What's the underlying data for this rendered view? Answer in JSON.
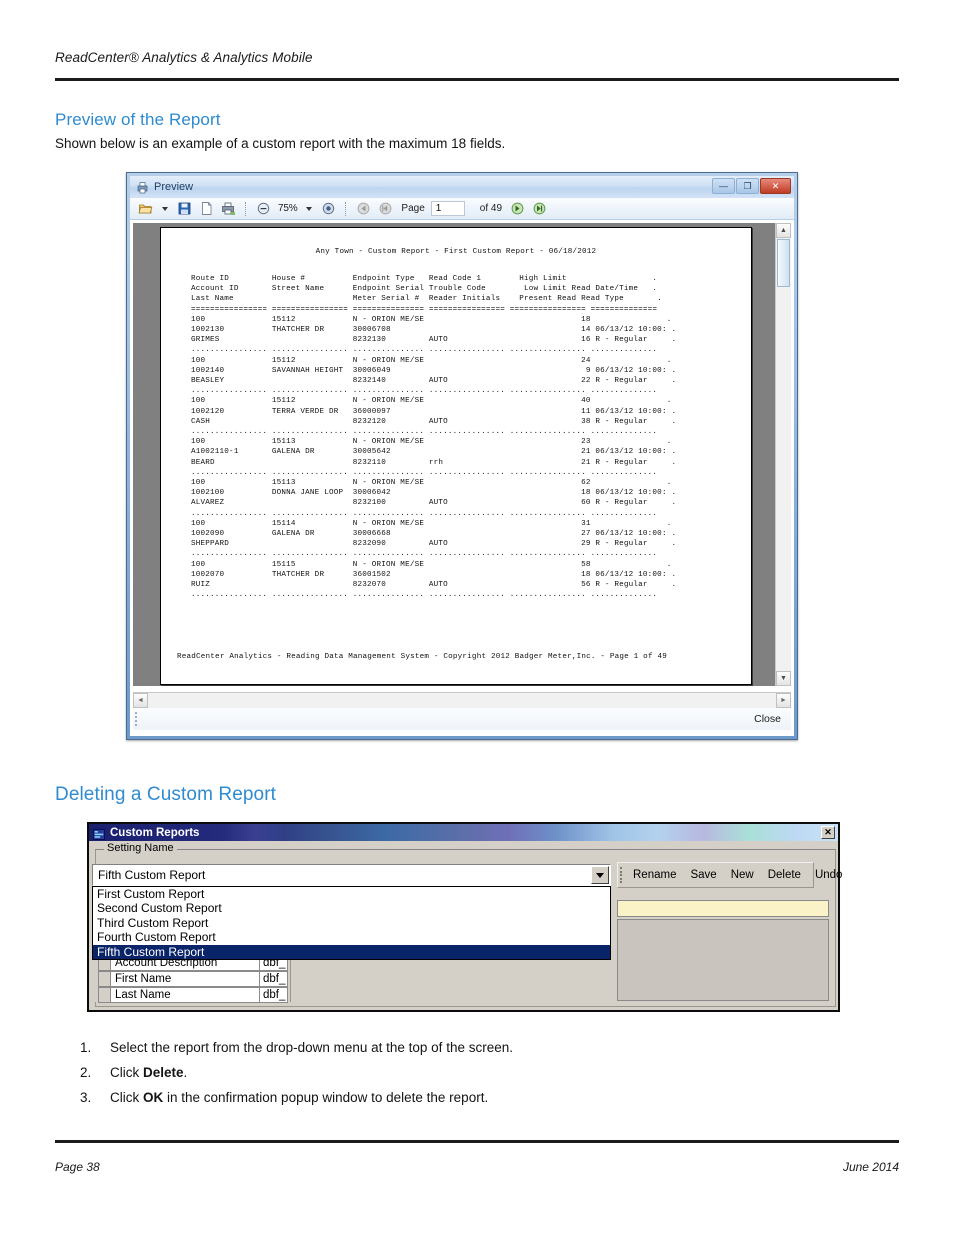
{
  "document": {
    "header_title": "ReadCenter® Analytics & Analytics Mobile",
    "footer_page": "Page 38",
    "footer_date": "June 2014",
    "heading_preview": "Preview of the Report",
    "intro_text": "Shown below is an example of a custom report with the maximum 18 fields.",
    "heading_deleting": "Deleting a Custom Report",
    "accent_color": "#2e8bd0"
  },
  "preview_window": {
    "title": "Preview",
    "title_icon": "printer-preview-icon",
    "window_buttons": {
      "minimize": "—",
      "maximize": "❐",
      "close": "✕"
    },
    "toolbar": {
      "open_label": "open-icon",
      "open_caret": "▾",
      "save_label": "save-icon",
      "new_label": "new-page-icon",
      "print_label": "print-icon",
      "zoom_out": "⊖",
      "zoom_value": "75%",
      "zoom_caret": "▾",
      "zoom_in": "⊕",
      "first_page": "◁",
      "prev_page": "◁",
      "page_word": "Page",
      "page_number": "1",
      "of_pages": "of 49",
      "next_page": "▷",
      "last_page": "▷"
    },
    "status_close_label": "Close"
  },
  "report": {
    "title": "Any Town - Custom Report - First Custom Report - 06/18/2012",
    "body": "Route ID         House #          Endpoint Type   Read Code 1        High Limit                  .\nAccount ID       Street Name      Endpoint Serial Trouble Code        Low Limit Read Date/Time   .\nLast Name                         Meter Serial #  Reader Initials    Present Read Read Type       .\n================ ================ =============== ================ ================ ==============\n100              15112            N - ORION ME/SE                                 18                .\n1002130          THATCHER DR      30006708                                        14 06/13/12 10:00: .\nGRIMES                            8232130         AUTO                            16 R - Regular     .\n................ ................ ............... ................ ................ ..............\n100              15112            N - ORION ME/SE                                 24                .\n1002140          SAVANNAH HEIGHT  30006049                                         9 06/13/12 10:00: .\nBEASLEY                           8232140         AUTO                            22 R - Regular     .\n................ ................ ............... ................ ................ ..............\n100              15112            N - ORION ME/SE                                 40                .\n1002120          TERRA VERDE DR   36000097                                        11 06/13/12 10:00: .\nCASH                              8232120         AUTO                            38 R - Regular     .\n................ ................ ............... ................ ................ ..............\n100              15113            N - ORION ME/SE                                 23                .\nA1002110-1       GALENA DR        30005642                                        21 06/13/12 10:00: .\nBEARD                             8232110         rrh                             21 R - Regular     .\n................ ................ ............... ................ ................ ..............\n100              15113            N - ORION ME/SE                                 62                .\n1002100          DONNA JANE LOOP  30006042                                        18 06/13/12 10:00: .\nALVAREZ                           8232100         AUTO                            60 R - Regular     .\n................ ................ ............... ................ ................ ..............\n100              15114            N - ORION ME/SE                                 31                .\n1002090          GALENA DR        30006668                                        27 06/13/12 10:00: .\nSHEPPARD                          8232090         AUTO                            29 R - Regular     .\n................ ................ ............... ................ ................ ..............\n100              15115            N - ORION ME/SE                                 58                .\n1002070          THATCHER DR      36001502                                        18 06/13/12 10:00: .\nRUIZ                              8232070         AUTO                            56 R - Regular     .\n................ ................ ............... ................ ................ ..............",
    "footer": "ReadCenter Analytics - Reading Data Management System - Copyright 2012 Badger Meter,Inc. - Page 1 of 49"
  },
  "custom_reports_dialog": {
    "title": "Custom Reports",
    "title_icon": "app-window-icon",
    "close_label": "✕",
    "group_legend": "Setting Name",
    "combo_value": "Fifth Custom Report",
    "dropdown_options": [
      "First Custom Report",
      "Second Custom Report",
      "Third Custom Report",
      "Fourth Custom Report",
      "Fifth Custom Report"
    ],
    "dropdown_selected_index": 4,
    "buttons": [
      "Rename",
      "Save",
      "New",
      "Delete",
      "Undo"
    ],
    "field_rows": [
      {
        "name": "Account Description",
        "type": "dbf_"
      },
      {
        "name": "First Name",
        "type": "dbf_"
      },
      {
        "name": "Last Name",
        "type": "dbf_"
      }
    ],
    "highlight_color": "#0a246a",
    "yellow_field_color": "#fbf3c8"
  },
  "steps": [
    {
      "num": "1.",
      "html": "Select the report from the drop-down menu at the top of the screen."
    },
    {
      "num": "2.",
      "html": "Click <b>Delete</b>."
    },
    {
      "num": "3.",
      "html": "Click <b>OK</b> in the confirmation popup window to delete the report."
    }
  ]
}
